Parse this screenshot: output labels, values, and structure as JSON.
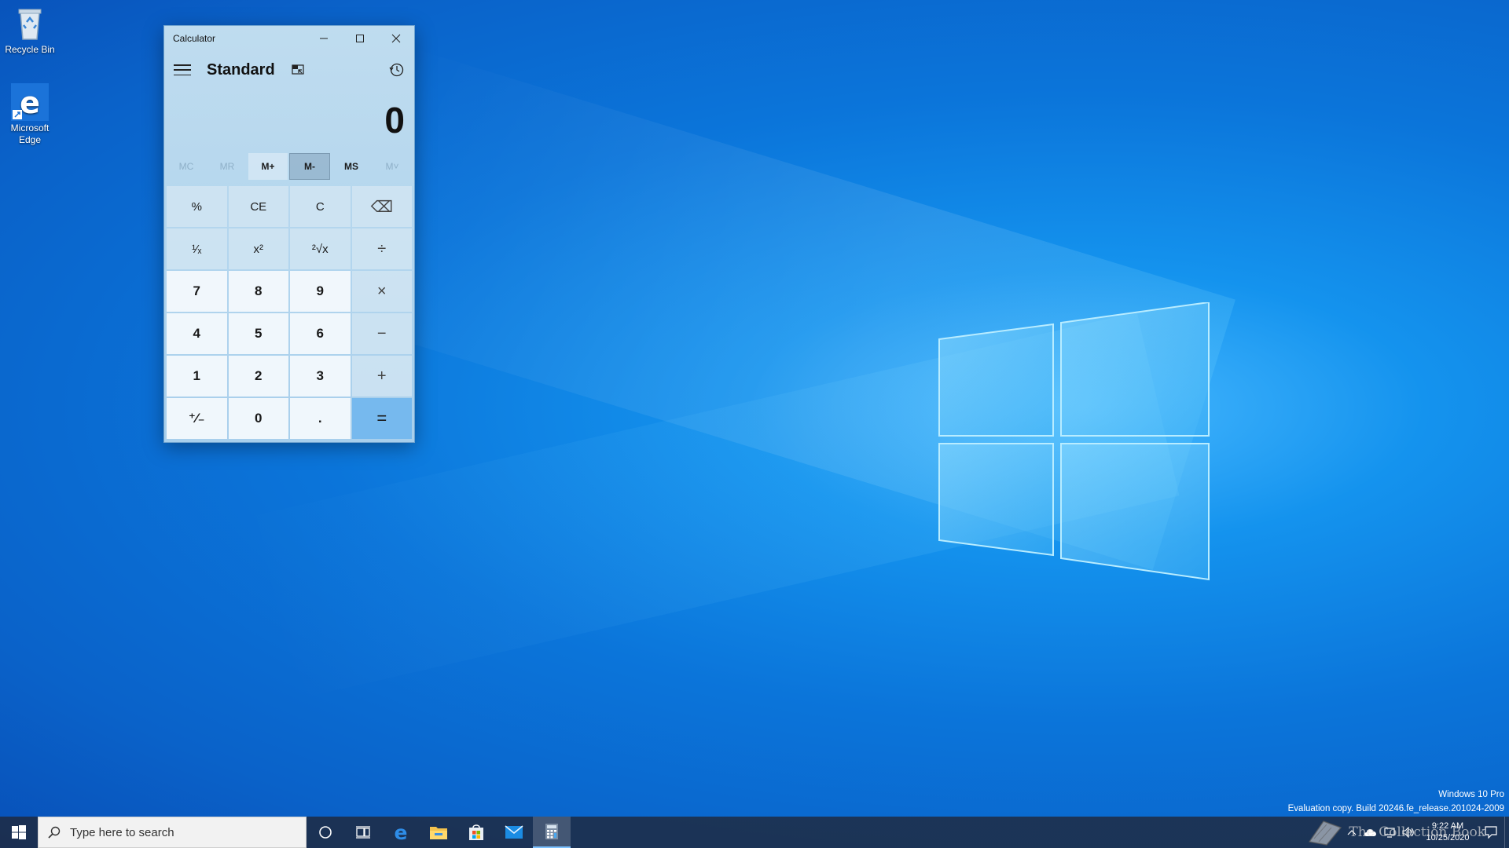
{
  "desktop": {
    "icons": [
      {
        "label": "Recycle Bin",
        "icon": "recycle-bin-icon"
      },
      {
        "label": "Microsoft Edge",
        "icon": "edge-icon"
      }
    ]
  },
  "calculator": {
    "window_title": "Calculator",
    "mode": "Standard",
    "display_value": "0",
    "memory_buttons": [
      "MC",
      "MR",
      "M+",
      "M-",
      "MS",
      "M˅"
    ],
    "keys": [
      "%",
      "CE",
      "C",
      "⌫",
      "¹⁄ₓ",
      "x²",
      "²√x",
      "÷",
      "7",
      "8",
      "9",
      "×",
      "4",
      "5",
      "6",
      "−",
      "1",
      "2",
      "3",
      "+",
      "⁺⁄₋",
      "0",
      ".",
      "="
    ]
  },
  "watermark": {
    "line1": "Windows 10 Pro",
    "line2": "Evaluation copy. Build 20246.fe_release.201024-2009"
  },
  "taskbar": {
    "search_placeholder": "Type here to search",
    "pinned": [
      "cortana-icon",
      "task-view-icon",
      "edge-icon",
      "file-explorer-icon",
      "store-icon",
      "mail-icon",
      "calculator-icon"
    ],
    "clock_time": "9:22 AM",
    "clock_date": "10/25/2020",
    "overlay_text": "The Collection Book"
  },
  "colors": {
    "accent": "#76b9ee",
    "taskbar": "#20283c"
  }
}
